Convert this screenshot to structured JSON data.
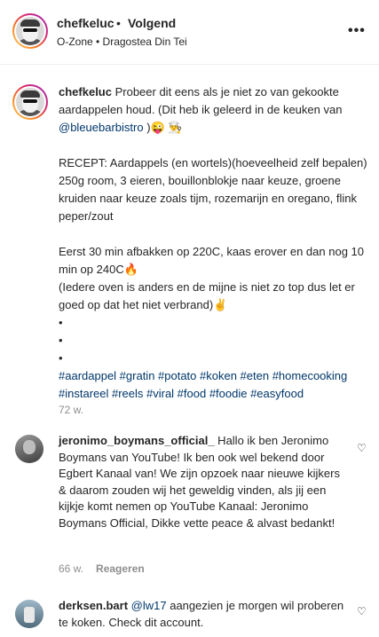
{
  "header": {
    "username": "chefkeluc",
    "dot": "•",
    "follow_label": "Volgend",
    "audio": "O-Zone • Dragostea Din Tei",
    "more_icon": "more-horizontal-icon",
    "more_glyph": "•••"
  },
  "caption": {
    "username": "chefkeluc",
    "intro": " Probeer dit eens als je niet zo van gekookte aardappelen houd. (Dit heb ik geleerd in de keuken van ",
    "mention": "@bleuebarbistro",
    "intro_end": " )😜 👨‍🍳",
    "recipe": "RECEPT: Aardappels (en wortels)(hoeveelheid zelf bepalen) 250g room, 3 eieren, bouillonblokje naar keuze, groene kruiden naar keuze zoals tijm, rozemarijn en oregano, flink peper/zout",
    "steps_1": "Eerst 30 min afbakken op 220C, kaas erover en dan nog 10 min op 240C🔥",
    "steps_2": "(Iedere oven is anders en de mijne is niet zo top dus let er goed op dat het niet verbrand)✌",
    "bullet_1": "•",
    "bullet_2": "•",
    "bullet_3": "•",
    "hashtags": "#aardappel #gratin #potato #koken #eten #homecooking #instareel #reels #viral #food #foodie #easyfood",
    "timestamp": "72 w."
  },
  "comments": [
    {
      "username": "jeronimo_boymans_official_",
      "text": " Hallo ik ben Jeronimo Boymans van YouTube! Ik ben ook wel bekend door Egbert Kanaal van! We zijn opzoek naar nieuwe kijkers & daarom zouden wij het geweldig vinden, als jij een kijkje komt nemen op YouTube Kanaal: Jeronimo Boymans Official, Dikke vette peace & alvast bedankt!",
      "time": "66 w.",
      "reply_label": "Reageren",
      "like_icon": "heart-icon",
      "like_glyph": "♡"
    },
    {
      "username": "derksen.bart",
      "mention": "@lw17",
      "text": " aangezien je morgen wil proberen te koken. Check dit account.",
      "like_icon": "heart-icon",
      "like_glyph": "♡"
    }
  ]
}
